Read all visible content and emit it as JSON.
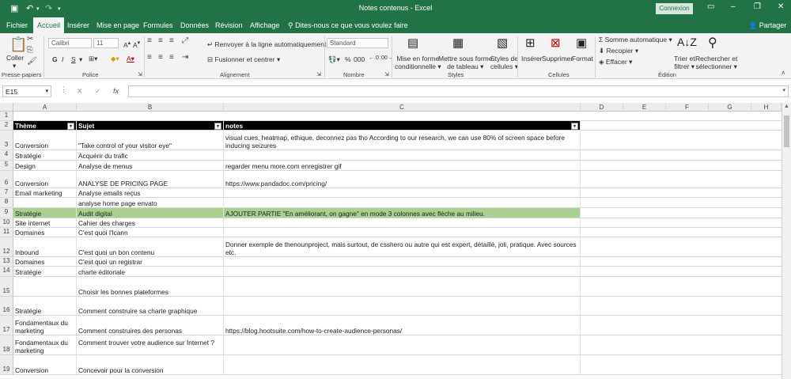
{
  "titlebar": {
    "title": "Notes contenus - Excel",
    "connexion": "Connexion"
  },
  "tabs": [
    {
      "label": "Fichier"
    },
    {
      "label": "Accueil"
    },
    {
      "label": "Insérer"
    },
    {
      "label": "Mise en page"
    },
    {
      "label": "Formules"
    },
    {
      "label": "Données"
    },
    {
      "label": "Révision"
    },
    {
      "label": "Affichage"
    }
  ],
  "tell_me": "Dites-nous ce que vous voulez faire",
  "share": "Partager",
  "ribbon": {
    "coller": "Coller",
    "presse_papiers": "Presse-papiers",
    "font_name": "Calibri",
    "font_size": "11",
    "bold": "G",
    "italic": "I",
    "underline": "S",
    "police": "Police",
    "wrap": "Renvoyer à la ligne automatiquement",
    "merge": "Fusionner et centrer",
    "alignement": "Alignement",
    "number_format": "Standard",
    "percent": "%",
    "thousands": "000",
    "nombre": "Nombre",
    "cond_format": [
      "Mise en forme",
      "conditionnelle"
    ],
    "table_format": [
      "Mettre sous forme",
      "de tableau"
    ],
    "cell_styles": [
      "Styles de",
      "cellules"
    ],
    "styles": "Styles",
    "insert": "Insérer",
    "delete": "Supprimer",
    "format": "Format",
    "cellules": "Cellules",
    "autosum": "Somme automatique",
    "fill": "Recopier",
    "clear": "Effacer",
    "sort": [
      "Trier et",
      "filtrer"
    ],
    "find": [
      "Rechercher et",
      "sélectionner"
    ],
    "edition": "Édition"
  },
  "namebox": "E15",
  "fx": "fx",
  "columns": [
    "A",
    "B",
    "C",
    "D",
    "E",
    "F",
    "G",
    "H"
  ],
  "header_row": {
    "num": "2",
    "a": "Thème",
    "b": "Sujet",
    "c": "notes"
  },
  "rows": [
    {
      "num": "1",
      "a": "",
      "b": "",
      "c": ""
    },
    {
      "num": "3",
      "a": "Conversion",
      "b": "\"Take control of your visitor eye\"",
      "c": "visual cues, heatmap, ethique, deconnez pas tho According to our research, we can use 80% of screen space before inducing seizures"
    },
    {
      "num": "4",
      "a": "Stratégie",
      "b": "Acquérir du trafic",
      "c": ""
    },
    {
      "num": "5",
      "a": "Design",
      "b": "Analyse de menus",
      "c": "regarder menu more.com enregistrer gif"
    },
    {
      "num": "6",
      "a": "Conversion",
      "b": "ANALYSE DE PRICING PAGE",
      "c": "https://www.pandadoc.com/pricing/"
    },
    {
      "num": "7",
      "a": "Email marketing",
      "b": "Analyse emails reçus",
      "c": ""
    },
    {
      "num": "8",
      "a": "",
      "b": "analyse home page envato",
      "c": ""
    },
    {
      "num": "9",
      "a": "Stratégie",
      "b": "Audit digital",
      "c": "AJOUTER PARTIE \"En améliorant, on gagne\" en mode 3 colonnes avec flèche au milieu."
    },
    {
      "num": "10",
      "a": "Site internet",
      "b": "Cahier des charges",
      "c": ""
    },
    {
      "num": "11",
      "a": "Domaines",
      "b": "C'est quoi l'Icann",
      "c": ""
    },
    {
      "num": "12",
      "a": "Inbound",
      "b": "C'est quoi un bon contenu",
      "c": "Donner exemple de thenounproject, mais surtout, de csshero ou autre qui est expert, détaillé, joli, pratique. Avec sources etc."
    },
    {
      "num": "13",
      "a": "Domaines",
      "b": "C'est quoi un registrar",
      "c": ""
    },
    {
      "num": "14",
      "a": "Stratégie",
      "b": "charte éditoriale",
      "c": ""
    },
    {
      "num": "15",
      "a": "",
      "b": "Choisir les bonnes plateformes",
      "c": ""
    },
    {
      "num": "16",
      "a": "Stratégie",
      "b": "Comment construire sa charte graphique",
      "c": ""
    },
    {
      "num": "17",
      "a": "Fondamentaux du marketing",
      "b": "Comment construires des personas",
      "c": "https://blog.hootsuite.com/how-to-create-audience-personas/"
    },
    {
      "num": "18",
      "a": "Fondamentaux du marketing",
      "b": "Comment trouver votre audience sur Internet ?",
      "c": ""
    },
    {
      "num": "19",
      "a": "Conversion",
      "b": "Concevoir pour la conversion",
      "c": ""
    }
  ]
}
